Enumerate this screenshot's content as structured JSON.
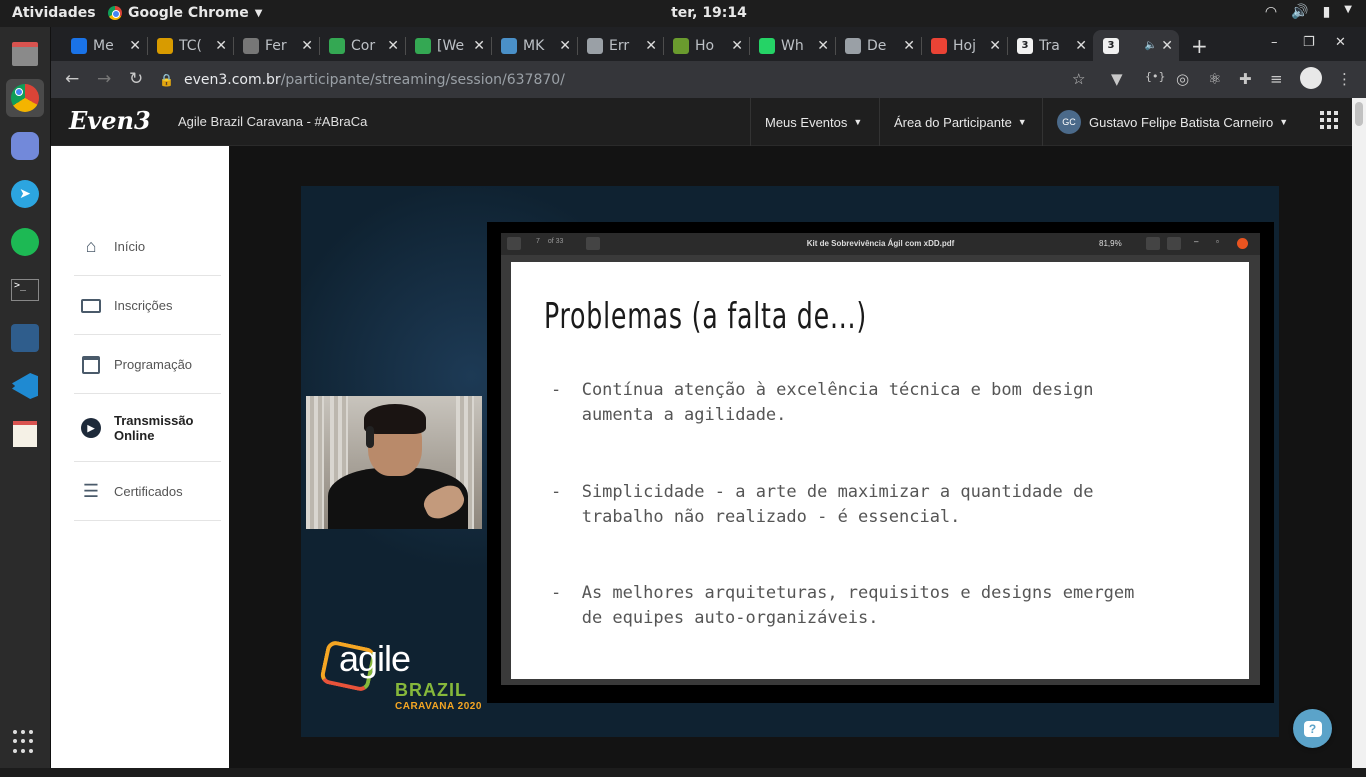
{
  "os": {
    "activities_label": "Atividades",
    "app_name": "Google Chrome",
    "clock": "ter, 19:14"
  },
  "tabs": [
    {
      "label": "Me",
      "icon": "google-drive-icon",
      "color": "#1a73e8"
    },
    {
      "label": "TC(",
      "icon": "bookmark-icon",
      "color": "#d89b00"
    },
    {
      "label": "Fer",
      "icon": "pixel-icon",
      "color": "#777"
    },
    {
      "label": "Cor",
      "icon": "e-icon",
      "color": "#34a853"
    },
    {
      "label": "[We",
      "icon": "e-icon",
      "color": "#34a853"
    },
    {
      "label": "MK",
      "icon": "mk-icon",
      "color": "#4a90c8"
    },
    {
      "label": "Err",
      "icon": "u-icon",
      "color": "#9aa0a6"
    },
    {
      "label": "Ho",
      "icon": "leaf-icon",
      "color": "#6a9b2e"
    },
    {
      "label": "Wh",
      "icon": "whatsapp-icon",
      "color": "#25d366"
    },
    {
      "label": "De",
      "icon": "globe-icon",
      "color": "#9aa0a6"
    },
    {
      "label": "Hoj",
      "icon": "gmail-icon",
      "color": "#ea4335"
    },
    {
      "label": "Tra",
      "icon": "three-icon",
      "color": "#ffffff"
    },
    {
      "label": "",
      "icon": "three-icon",
      "color": "#ffffff",
      "active": true
    }
  ],
  "address_bar": {
    "host": "even3.com.br",
    "path": "/participante/streaming/session/637870/"
  },
  "site_header": {
    "logo": "Even3",
    "event_title": "Agile Brazil Caravana - #ABraCa",
    "menu_events": "Meus Eventos",
    "menu_area": "Área do Participante",
    "user_initials": "GC",
    "user_name": "Gustavo Felipe Batista Carneiro"
  },
  "sidebar": {
    "items": [
      {
        "label": "Início",
        "icon": "home-icon"
      },
      {
        "label": "Inscrições",
        "icon": "ticket-icon"
      },
      {
        "label": "Programação",
        "icon": "calendar-icon"
      },
      {
        "label": "Transmissão Online",
        "line1": "Transmissão",
        "line2": "Online",
        "icon": "play-icon",
        "active": true
      },
      {
        "label": "Certificados",
        "icon": "certificate-icon"
      }
    ]
  },
  "stream": {
    "pdf_title": "Kit de Sobrevivência Ágil com xDD.pdf",
    "pdf_page": "7",
    "pdf_page_total": "of 33",
    "pdf_zoom": "81,9%",
    "slide_title": "Problemas (a falta de...)",
    "bullets": [
      "-  Contínua atenção à excelência técnica e bom design\n   aumenta a agilidade.",
      "-  Simplicidade - a arte de maximizar a quantidade de\n   trabalho não realizado - é essencial.",
      "-  As melhores arquiteturas, requisitos e designs emergem\n   de equipes auto-organizáveis."
    ],
    "brand_word": "agile",
    "brand_country": "BRAZIL",
    "brand_caption": "CARAVANA 2020"
  },
  "help_button": "?"
}
